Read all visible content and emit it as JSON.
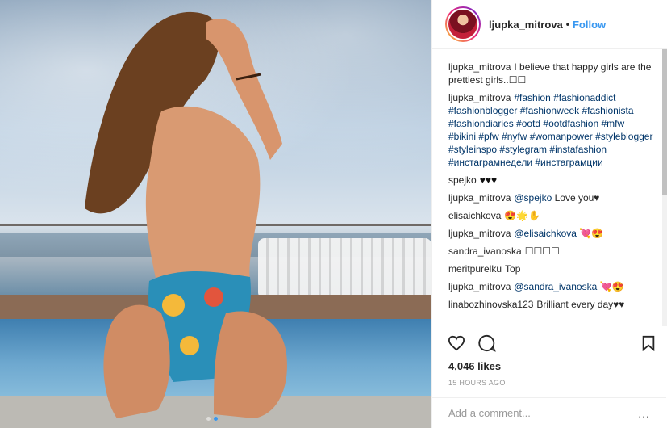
{
  "header": {
    "username": "ljupka_mitrova",
    "separator": "•",
    "follow_label": "Follow"
  },
  "comments": [
    {
      "user": "ljupka_mitrova",
      "text": "I believe that happy girls are the prettiest girls..☐☐"
    },
    {
      "user": "ljupka_mitrova",
      "text": "#fashion #fashionaddict #fashionblogger #fashionweek #fashionista #fashiondiaries #ootd #ootdfashion #mfw #bikini #pfw #nyfw #womanpower #styleblogger #styleinspo #stylegram #instafashion #инстаграмнедели #инстаграмции"
    },
    {
      "user": "spejko",
      "text": "♥♥♥"
    },
    {
      "user": "ljupka_mitrova",
      "mention": "@spejko",
      "text": "Love you♥"
    },
    {
      "user": "elisaichkova",
      "text": "😍🌟✋"
    },
    {
      "user": "ljupka_mitrova",
      "mention": "@elisaichkova",
      "text": "💘😍"
    },
    {
      "user": "sandra_ivanoska",
      "text": "☐☐☐☐"
    },
    {
      "user": "meritpurelku",
      "text": "Top"
    },
    {
      "user": "ljupka_mitrova",
      "mention": "@sandra_ivanoska",
      "text": "💘😍"
    },
    {
      "user": "linabozhinovska123",
      "text": "Brilliant every day♥♥"
    }
  ],
  "actions": {
    "like_icon": "heart-icon",
    "comment_icon": "comment-icon",
    "save_icon": "bookmark-icon"
  },
  "likes": "4,046 likes",
  "timestamp": "15 HOURS AGO",
  "add_comment": {
    "placeholder": "Add a comment...",
    "more_label": "..."
  },
  "carousel": {
    "count": 2,
    "active": 2
  },
  "colors": {
    "link": "#003569",
    "follow": "#3897f0",
    "heart_red": "#d0021b"
  }
}
